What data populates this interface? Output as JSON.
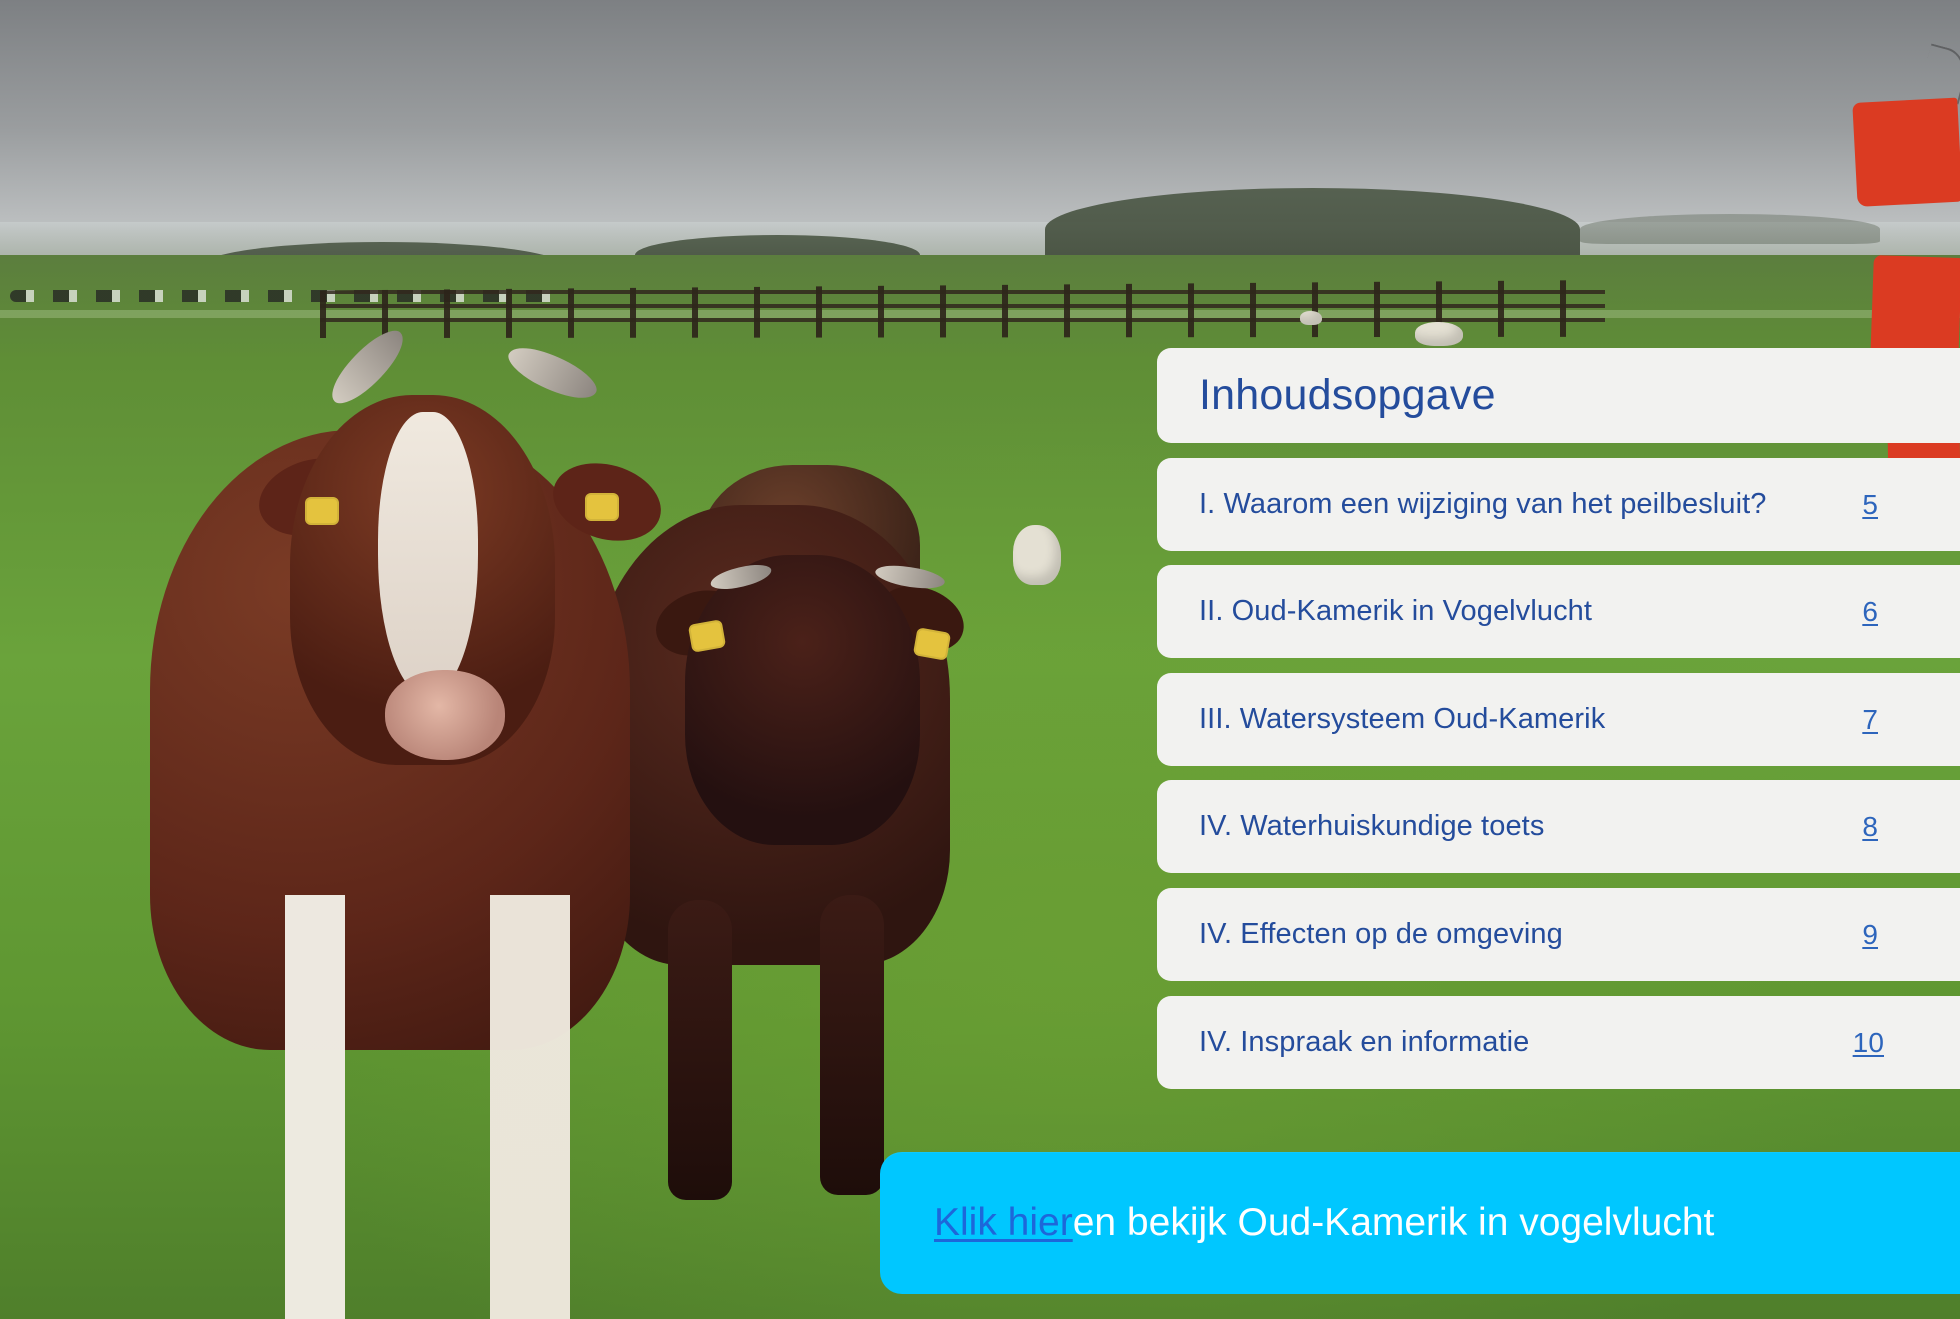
{
  "toc": {
    "title": "Inhoudsopgave",
    "items": [
      {
        "label": "I. Waarom een wijziging van het peilbesluit?",
        "page": "5"
      },
      {
        "label": "II. Oud-Kamerik in Vogelvlucht",
        "page": "6"
      },
      {
        "label": "III. Watersysteem Oud-Kamerik",
        "page": "7"
      },
      {
        "label": "IV. Waterhuiskundige toets",
        "page": "8"
      },
      {
        "label": "IV. Effecten op de omgeving",
        "page": "9"
      },
      {
        "label": "IV. Inspraak en informatie",
        "page": "10"
      }
    ]
  },
  "cta": {
    "link_text": "Klik hier ",
    "text": "en bekijk Oud-Kamerik in vogelvlucht"
  },
  "colors": {
    "accent_red": "#db3b22",
    "cta_blue": "#00c7ff",
    "link_blue": "#2d65bc",
    "title_blue": "#244c9c",
    "card_bg": "#f2f2f0"
  }
}
